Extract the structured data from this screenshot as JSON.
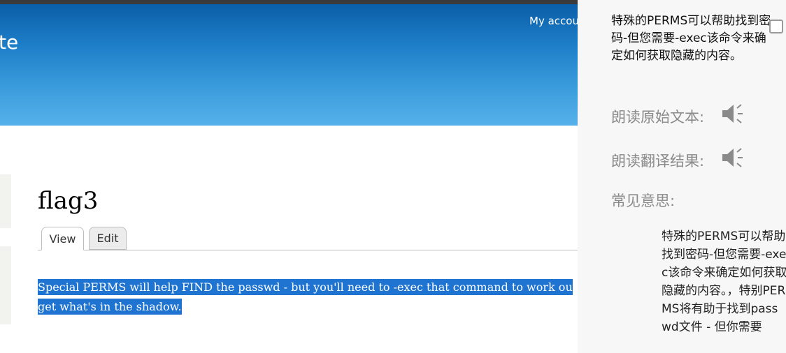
{
  "header": {
    "site_name": "te",
    "account_link": "My accou"
  },
  "node": {
    "title": "flag3",
    "tabs": [
      {
        "label": "View",
        "active": true
      },
      {
        "label": "Edit",
        "active": false
      }
    ],
    "body_line1": "Special PERMS will help FIND the passwd - but you'll need to -exec that command to work ou",
    "body_line2": "get what's in the shadow."
  },
  "translate_popup": {
    "translation": "特殊的PERMS可以帮助找到密码-但您需要-exec该命令来确定如何获取隐藏的内容。",
    "read_original_label": "朗读原始文本:",
    "read_translation_label": "朗读翻译结果:",
    "common_meaning_label": "常见意思:",
    "common_meaning_text": "特殊的PERMS可以帮助找到密码-但您需要-exec该命令来确定如何获取隐藏的内容。，特别PERMS将有助于找到passwd文件 - 但你需要",
    "speaker_icon": "speaker-icon"
  },
  "colors": {
    "header_top": "#0a5fa8",
    "header_bottom": "#56b1ea",
    "selection": "#1f74d2",
    "popup_bg": "#f7f7f7"
  }
}
